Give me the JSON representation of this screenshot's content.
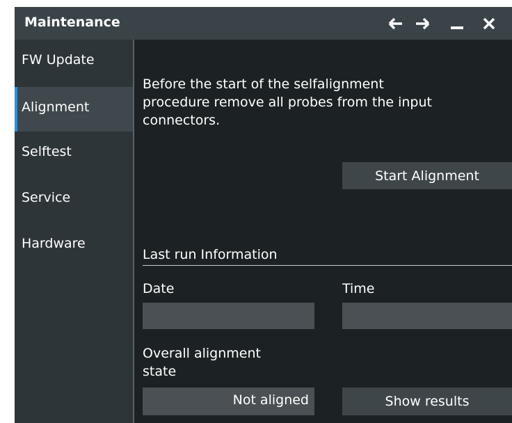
{
  "window": {
    "title": "Maintenance",
    "controls": [
      "arrow-left-icon",
      "arrow-right-icon",
      "minimize-icon",
      "close-icon"
    ]
  },
  "sidebar": {
    "items": [
      {
        "label": "FW Update",
        "active": false
      },
      {
        "label": "Alignment",
        "active": true
      },
      {
        "label": "Selftest",
        "active": false
      },
      {
        "label": "Service",
        "active": false
      },
      {
        "label": "Hardware",
        "active": false
      }
    ]
  },
  "main": {
    "description_lines": [
      "Before the start of the selfalignment",
      "procedure remove all probes from the input",
      "connectors."
    ],
    "start_button": "Start Alignment",
    "last_run": {
      "heading": "Last run Information",
      "date_label": "Date",
      "date_value": "",
      "time_label": "Time",
      "time_value": "",
      "state_label_lines": [
        "Overall alignment",
        "state"
      ],
      "state_value": "Not aligned",
      "show_results_button": "Show results"
    }
  },
  "colors": {
    "titlebar": "#3a4347",
    "sidebar": "#2e3538",
    "content": "#1c2224",
    "accent": "#2b8fe0",
    "button": "#3e464a",
    "field": "#4a5053"
  }
}
